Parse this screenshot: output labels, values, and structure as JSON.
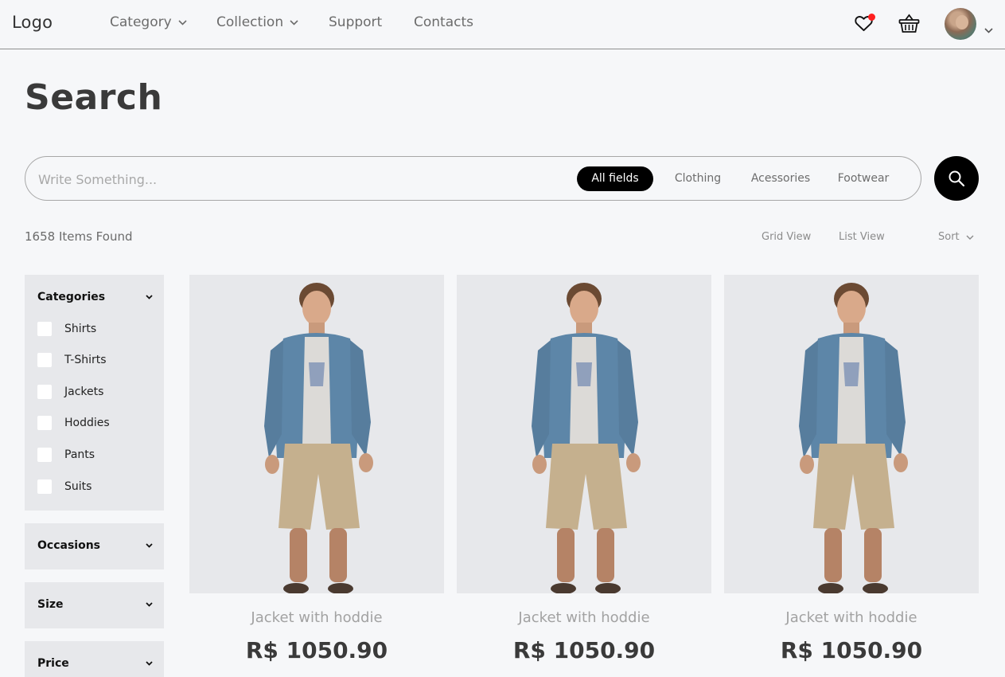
{
  "header": {
    "logo": "Logo",
    "nav": [
      {
        "label": "Category",
        "has_dropdown": true
      },
      {
        "label": "Collection",
        "has_dropdown": true
      },
      {
        "label": "Support",
        "has_dropdown": false
      },
      {
        "label": "Contacts",
        "has_dropdown": false
      }
    ],
    "icons": [
      "heart-icon",
      "basket-icon",
      "avatar",
      "chevron-down-icon"
    ]
  },
  "page": {
    "title": "Search"
  },
  "search": {
    "placeholder": "Write Something...",
    "value": "",
    "filters": [
      {
        "label": "All fields",
        "active": true
      },
      {
        "label": "Clothing",
        "active": false
      },
      {
        "label": "Acessories",
        "active": false
      },
      {
        "label": "Footwear",
        "active": false
      }
    ],
    "button_icon": "search-icon"
  },
  "results": {
    "count_text": "1658 Items Found",
    "views": [
      "Grid View",
      "List View"
    ],
    "sort_label": "Sort"
  },
  "sidebar": {
    "categories": {
      "title": "Categories",
      "items": [
        "Shirts",
        "T-Shirts",
        "Jackets",
        "Hoddies",
        "Pants",
        "Suits"
      ]
    },
    "occasions": {
      "title": "Occasions"
    },
    "size": {
      "title": "Size"
    },
    "price": {
      "title": "Price"
    }
  },
  "products": [
    {
      "name": "Jacket with hoddie",
      "price": "R$ 1050.90"
    },
    {
      "name": "Jacket with hoddie",
      "price": "R$ 1050.90"
    },
    {
      "name": "Jacket with hoddie",
      "price": "R$ 1050.90"
    }
  ],
  "colors": {
    "accent": "#000000",
    "notification": "#ff1f1f",
    "panel_bg": "#e7e8eb",
    "page_bg": "#f6f7f9"
  }
}
